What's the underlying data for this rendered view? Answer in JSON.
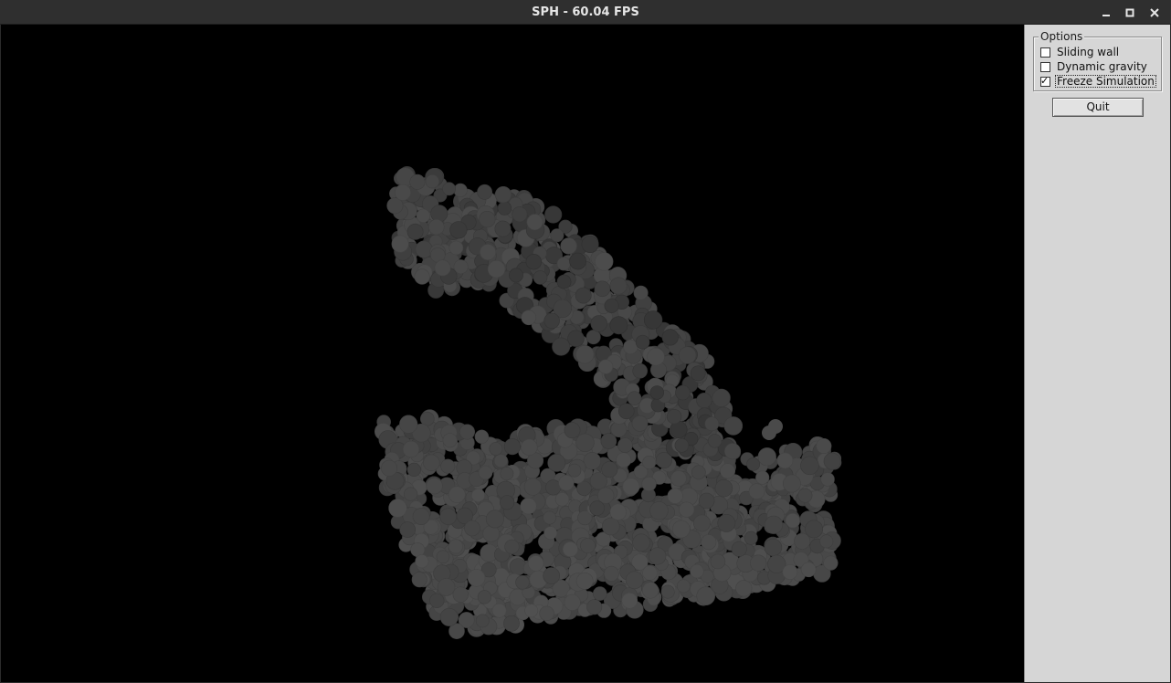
{
  "window": {
    "title": "SPH - 60.04 FPS",
    "controls": [
      "minimize-icon",
      "maximize-icon",
      "close-icon"
    ]
  },
  "colors": {
    "titlebar": "#2f2f2f",
    "canvas_bg": "#000000",
    "particle": "#444444",
    "panel_bg": "#d6d6d6"
  },
  "panel": {
    "group_title": "Options",
    "options": [
      {
        "label": "Sliding wall",
        "checked": false
      },
      {
        "label": "Dynamic gravity",
        "checked": false
      },
      {
        "label": "Freeze Simulation",
        "checked": true
      }
    ],
    "check_mark": "✓",
    "quit_label": "Quit"
  }
}
